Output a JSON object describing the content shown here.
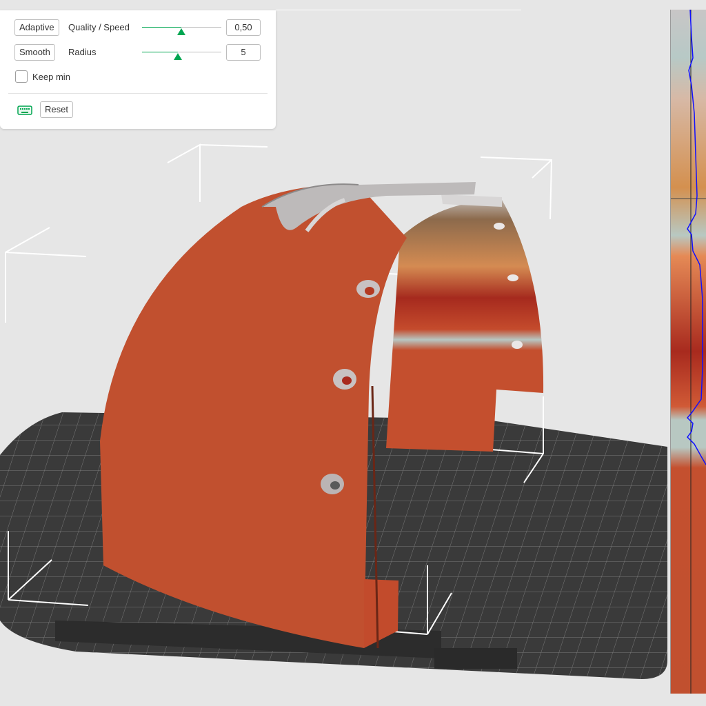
{
  "panel": {
    "adaptive_label": "Adaptive",
    "quality_label": "Quality / Speed",
    "quality_value": "0,50",
    "quality_fraction": 0.5,
    "smooth_label": "Smooth",
    "radius_label": "Radius",
    "radius_value": "5",
    "radius_fraction": 0.45,
    "keep_min_label": "Keep min",
    "keep_min_checked": false,
    "reset_label": "Reset"
  },
  "icons": {
    "keyboard": "keyboard-icon"
  },
  "colors": {
    "accent": "#00a651",
    "low_layer": "#c0502f",
    "mid_layer": "#a82a1e",
    "high_layer": "#e0a060",
    "top_layer": "#d6d2d0",
    "graph_line": "#1010ff"
  }
}
